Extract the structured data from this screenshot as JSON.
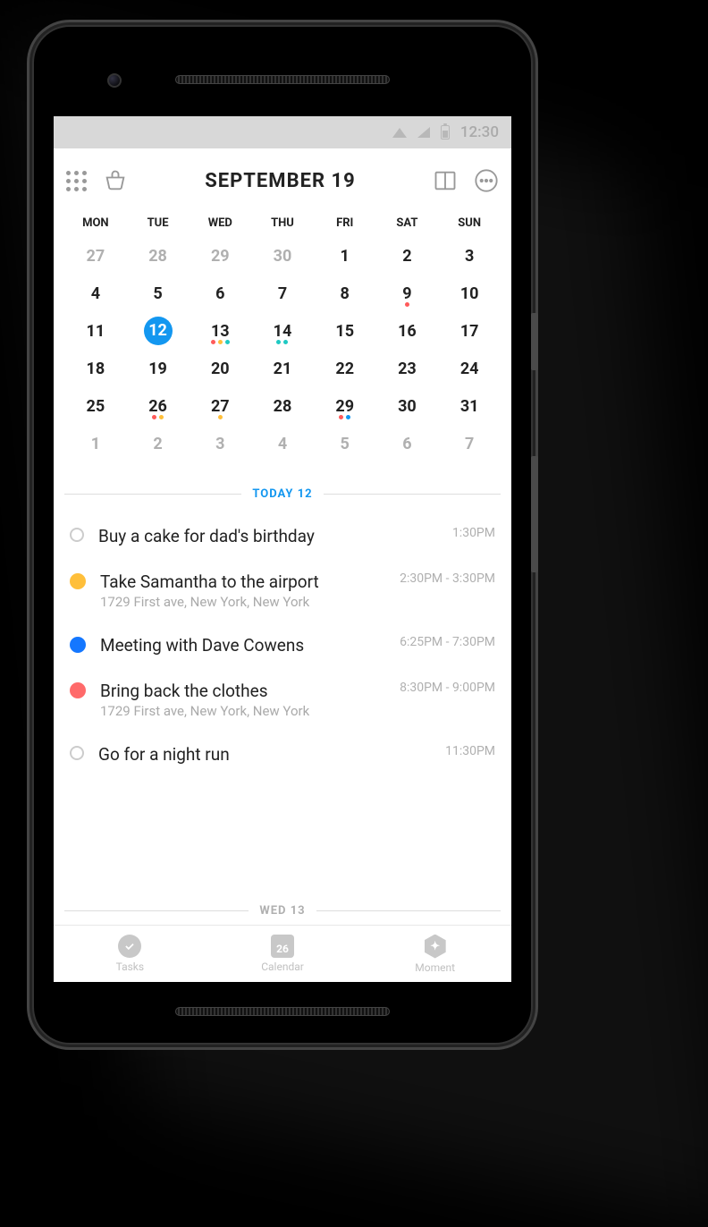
{
  "status": {
    "time": "12:30"
  },
  "header": {
    "title": "SEPTEMBER 19"
  },
  "calendar": {
    "weekdays": [
      "MON",
      "TUE",
      "WED",
      "THU",
      "FRI",
      "SAT",
      "SUN"
    ],
    "rows": [
      [
        {
          "n": "27",
          "muted": true
        },
        {
          "n": "28",
          "muted": true
        },
        {
          "n": "29",
          "muted": true
        },
        {
          "n": "30",
          "muted": true
        },
        {
          "n": "1"
        },
        {
          "n": "2"
        },
        {
          "n": "3"
        }
      ],
      [
        {
          "n": "4"
        },
        {
          "n": "5"
        },
        {
          "n": "6"
        },
        {
          "n": "7"
        },
        {
          "n": "8"
        },
        {
          "n": "9",
          "dots": [
            "red"
          ]
        },
        {
          "n": "10"
        }
      ],
      [
        {
          "n": "11"
        },
        {
          "n": "12",
          "selected": true
        },
        {
          "n": "13",
          "dots": [
            "red",
            "yellow",
            "teal"
          ]
        },
        {
          "n": "14",
          "dots": [
            "teal",
            "teal"
          ]
        },
        {
          "n": "15"
        },
        {
          "n": "16"
        },
        {
          "n": "17"
        }
      ],
      [
        {
          "n": "18"
        },
        {
          "n": "19"
        },
        {
          "n": "20"
        },
        {
          "n": "21"
        },
        {
          "n": "22"
        },
        {
          "n": "23"
        },
        {
          "n": "24"
        }
      ],
      [
        {
          "n": "25"
        },
        {
          "n": "26",
          "dots": [
            "red",
            "yellow"
          ]
        },
        {
          "n": "27",
          "dots": [
            "yellow"
          ]
        },
        {
          "n": "28"
        },
        {
          "n": "29",
          "dots": [
            "red",
            "blue"
          ]
        },
        {
          "n": "30"
        },
        {
          "n": "31"
        }
      ],
      [
        {
          "n": "1",
          "muted": true
        },
        {
          "n": "2",
          "muted": true
        },
        {
          "n": "3",
          "muted": true
        },
        {
          "n": "4",
          "muted": true
        },
        {
          "n": "5",
          "muted": true
        },
        {
          "n": "6",
          "muted": true
        },
        {
          "n": "7",
          "muted": true
        }
      ]
    ]
  },
  "sections": {
    "today_label": "TODAY 12",
    "next_label": "WED 13"
  },
  "events": [
    {
      "color": "outline",
      "title": "Buy a cake for dad's birthday",
      "sub": "",
      "time": "1:30PM"
    },
    {
      "color": "yellow",
      "title": "Take Samantha to the airport",
      "sub": "1729 First ave, New York, New York",
      "time": "2:30PM - 3:30PM"
    },
    {
      "color": "blue",
      "title": "Meeting with Dave Cowens",
      "sub": "",
      "time": "6:25PM - 7:30PM"
    },
    {
      "color": "red",
      "title": "Bring back the clothes",
      "sub": "1729 First ave, New York, New York",
      "time": "8:30PM - 9:00PM"
    },
    {
      "color": "outline",
      "title": "Go for a night run",
      "sub": "",
      "time": "11:30PM"
    }
  ],
  "nav": {
    "tasks": "Tasks",
    "calendar": "Calendar",
    "calendar_badge": "26",
    "moment": "Moment"
  }
}
